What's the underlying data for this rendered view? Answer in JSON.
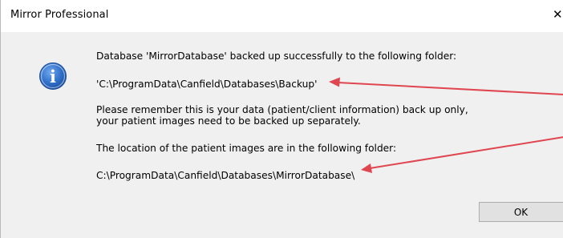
{
  "window": {
    "title": "Mirror Professional",
    "close_glyph": "✕"
  },
  "icon": {
    "name": "info-icon",
    "glyph": "i",
    "color": "#2f6fc8"
  },
  "message": {
    "line1": "Database 'MirrorDatabase' backed up successfully to the following folder:",
    "backup_path": "'C:\\ProgramData\\Canfield\\Databases\\Backup'",
    "note_line1": "Please remember this is your data (patient/client information) back up only,",
    "note_line2": "your patient images need to be backed up separately.",
    "images_line": "The location of the patient images are in the following folder:",
    "images_path": "C:\\ProgramData\\Canfield\\Databases\\MirrorDatabase\\"
  },
  "buttons": {
    "ok_label": "OK"
  },
  "annotation": {
    "arrow_color": "#e0464f"
  }
}
